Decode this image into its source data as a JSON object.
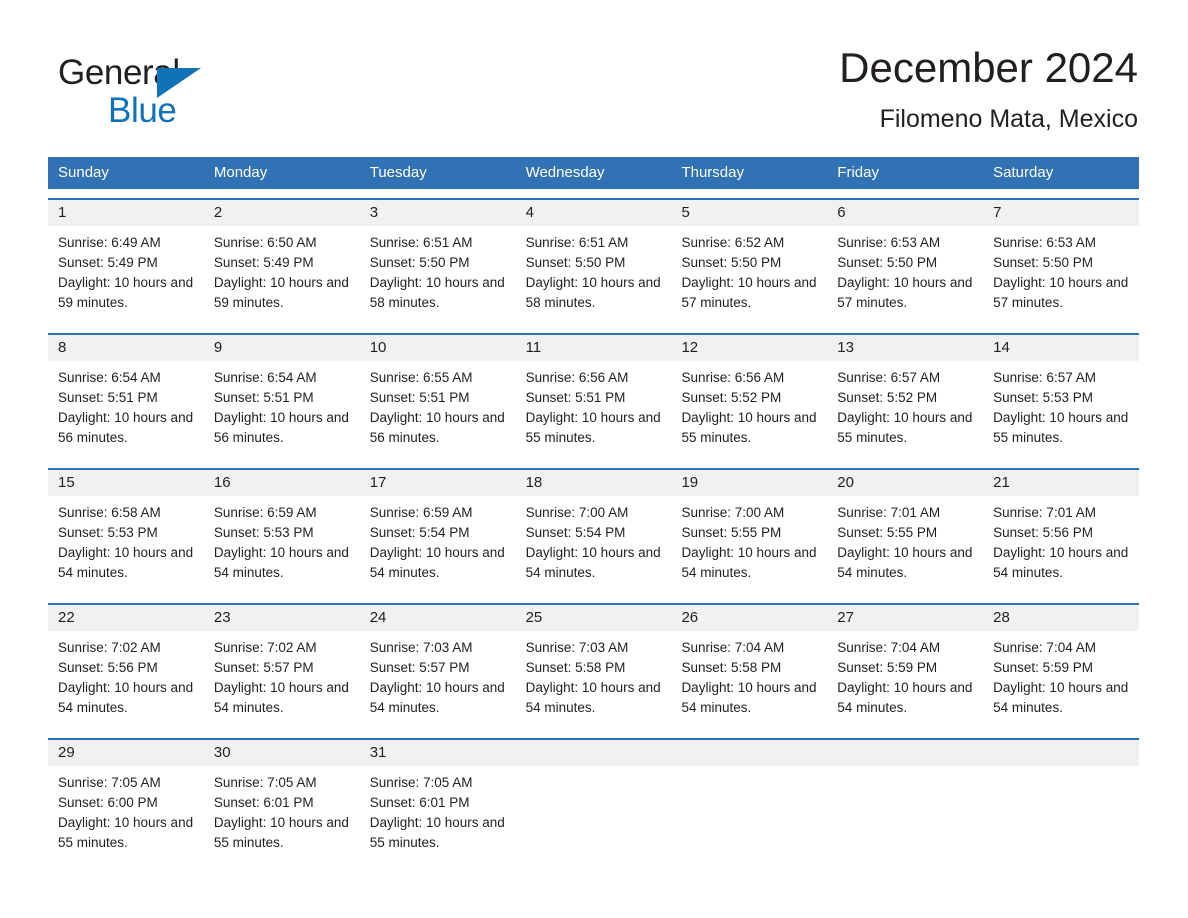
{
  "brand": {
    "name_part1": "General",
    "name_part2": "Blue",
    "accent_color": "#1272b6"
  },
  "header": {
    "title": "December 2024",
    "subtitle": "Filomeno Mata, Mexico"
  },
  "calendar": {
    "header_color": "#3172b5",
    "row_divider_color": "#2e72b8",
    "daynum_band_color": "#f1f1f1",
    "weekdays": [
      "Sunday",
      "Monday",
      "Tuesday",
      "Wednesday",
      "Thursday",
      "Friday",
      "Saturday"
    ],
    "weeks": [
      [
        {
          "day": "1",
          "sunrise": "Sunrise: 6:49 AM",
          "sunset": "Sunset: 5:49 PM",
          "daylight": "Daylight: 10 hours and 59 minutes."
        },
        {
          "day": "2",
          "sunrise": "Sunrise: 6:50 AM",
          "sunset": "Sunset: 5:49 PM",
          "daylight": "Daylight: 10 hours and 59 minutes."
        },
        {
          "day": "3",
          "sunrise": "Sunrise: 6:51 AM",
          "sunset": "Sunset: 5:50 PM",
          "daylight": "Daylight: 10 hours and 58 minutes."
        },
        {
          "day": "4",
          "sunrise": "Sunrise: 6:51 AM",
          "sunset": "Sunset: 5:50 PM",
          "daylight": "Daylight: 10 hours and 58 minutes."
        },
        {
          "day": "5",
          "sunrise": "Sunrise: 6:52 AM",
          "sunset": "Sunset: 5:50 PM",
          "daylight": "Daylight: 10 hours and 57 minutes."
        },
        {
          "day": "6",
          "sunrise": "Sunrise: 6:53 AM",
          "sunset": "Sunset: 5:50 PM",
          "daylight": "Daylight: 10 hours and 57 minutes."
        },
        {
          "day": "7",
          "sunrise": "Sunrise: 6:53 AM",
          "sunset": "Sunset: 5:50 PM",
          "daylight": "Daylight: 10 hours and 57 minutes."
        }
      ],
      [
        {
          "day": "8",
          "sunrise": "Sunrise: 6:54 AM",
          "sunset": "Sunset: 5:51 PM",
          "daylight": "Daylight: 10 hours and 56 minutes."
        },
        {
          "day": "9",
          "sunrise": "Sunrise: 6:54 AM",
          "sunset": "Sunset: 5:51 PM",
          "daylight": "Daylight: 10 hours and 56 minutes."
        },
        {
          "day": "10",
          "sunrise": "Sunrise: 6:55 AM",
          "sunset": "Sunset: 5:51 PM",
          "daylight": "Daylight: 10 hours and 56 minutes."
        },
        {
          "day": "11",
          "sunrise": "Sunrise: 6:56 AM",
          "sunset": "Sunset: 5:51 PM",
          "daylight": "Daylight: 10 hours and 55 minutes."
        },
        {
          "day": "12",
          "sunrise": "Sunrise: 6:56 AM",
          "sunset": "Sunset: 5:52 PM",
          "daylight": "Daylight: 10 hours and 55 minutes."
        },
        {
          "day": "13",
          "sunrise": "Sunrise: 6:57 AM",
          "sunset": "Sunset: 5:52 PM",
          "daylight": "Daylight: 10 hours and 55 minutes."
        },
        {
          "day": "14",
          "sunrise": "Sunrise: 6:57 AM",
          "sunset": "Sunset: 5:53 PM",
          "daylight": "Daylight: 10 hours and 55 minutes."
        }
      ],
      [
        {
          "day": "15",
          "sunrise": "Sunrise: 6:58 AM",
          "sunset": "Sunset: 5:53 PM",
          "daylight": "Daylight: 10 hours and 54 minutes."
        },
        {
          "day": "16",
          "sunrise": "Sunrise: 6:59 AM",
          "sunset": "Sunset: 5:53 PM",
          "daylight": "Daylight: 10 hours and 54 minutes."
        },
        {
          "day": "17",
          "sunrise": "Sunrise: 6:59 AM",
          "sunset": "Sunset: 5:54 PM",
          "daylight": "Daylight: 10 hours and 54 minutes."
        },
        {
          "day": "18",
          "sunrise": "Sunrise: 7:00 AM",
          "sunset": "Sunset: 5:54 PM",
          "daylight": "Daylight: 10 hours and 54 minutes."
        },
        {
          "day": "19",
          "sunrise": "Sunrise: 7:00 AM",
          "sunset": "Sunset: 5:55 PM",
          "daylight": "Daylight: 10 hours and 54 minutes."
        },
        {
          "day": "20",
          "sunrise": "Sunrise: 7:01 AM",
          "sunset": "Sunset: 5:55 PM",
          "daylight": "Daylight: 10 hours and 54 minutes."
        },
        {
          "day": "21",
          "sunrise": "Sunrise: 7:01 AM",
          "sunset": "Sunset: 5:56 PM",
          "daylight": "Daylight: 10 hours and 54 minutes."
        }
      ],
      [
        {
          "day": "22",
          "sunrise": "Sunrise: 7:02 AM",
          "sunset": "Sunset: 5:56 PM",
          "daylight": "Daylight: 10 hours and 54 minutes."
        },
        {
          "day": "23",
          "sunrise": "Sunrise: 7:02 AM",
          "sunset": "Sunset: 5:57 PM",
          "daylight": "Daylight: 10 hours and 54 minutes."
        },
        {
          "day": "24",
          "sunrise": "Sunrise: 7:03 AM",
          "sunset": "Sunset: 5:57 PM",
          "daylight": "Daylight: 10 hours and 54 minutes."
        },
        {
          "day": "25",
          "sunrise": "Sunrise: 7:03 AM",
          "sunset": "Sunset: 5:58 PM",
          "daylight": "Daylight: 10 hours and 54 minutes."
        },
        {
          "day": "26",
          "sunrise": "Sunrise: 7:04 AM",
          "sunset": "Sunset: 5:58 PM",
          "daylight": "Daylight: 10 hours and 54 minutes."
        },
        {
          "day": "27",
          "sunrise": "Sunrise: 7:04 AM",
          "sunset": "Sunset: 5:59 PM",
          "daylight": "Daylight: 10 hours and 54 minutes."
        },
        {
          "day": "28",
          "sunrise": "Sunrise: 7:04 AM",
          "sunset": "Sunset: 5:59 PM",
          "daylight": "Daylight: 10 hours and 54 minutes."
        }
      ],
      [
        {
          "day": "29",
          "sunrise": "Sunrise: 7:05 AM",
          "sunset": "Sunset: 6:00 PM",
          "daylight": "Daylight: 10 hours and 55 minutes."
        },
        {
          "day": "30",
          "sunrise": "Sunrise: 7:05 AM",
          "sunset": "Sunset: 6:01 PM",
          "daylight": "Daylight: 10 hours and 55 minutes."
        },
        {
          "day": "31",
          "sunrise": "Sunrise: 7:05 AM",
          "sunset": "Sunset: 6:01 PM",
          "daylight": "Daylight: 10 hours and 55 minutes."
        },
        {
          "day": "",
          "sunrise": "",
          "sunset": "",
          "daylight": ""
        },
        {
          "day": "",
          "sunrise": "",
          "sunset": "",
          "daylight": ""
        },
        {
          "day": "",
          "sunrise": "",
          "sunset": "",
          "daylight": ""
        },
        {
          "day": "",
          "sunrise": "",
          "sunset": "",
          "daylight": ""
        }
      ]
    ]
  }
}
